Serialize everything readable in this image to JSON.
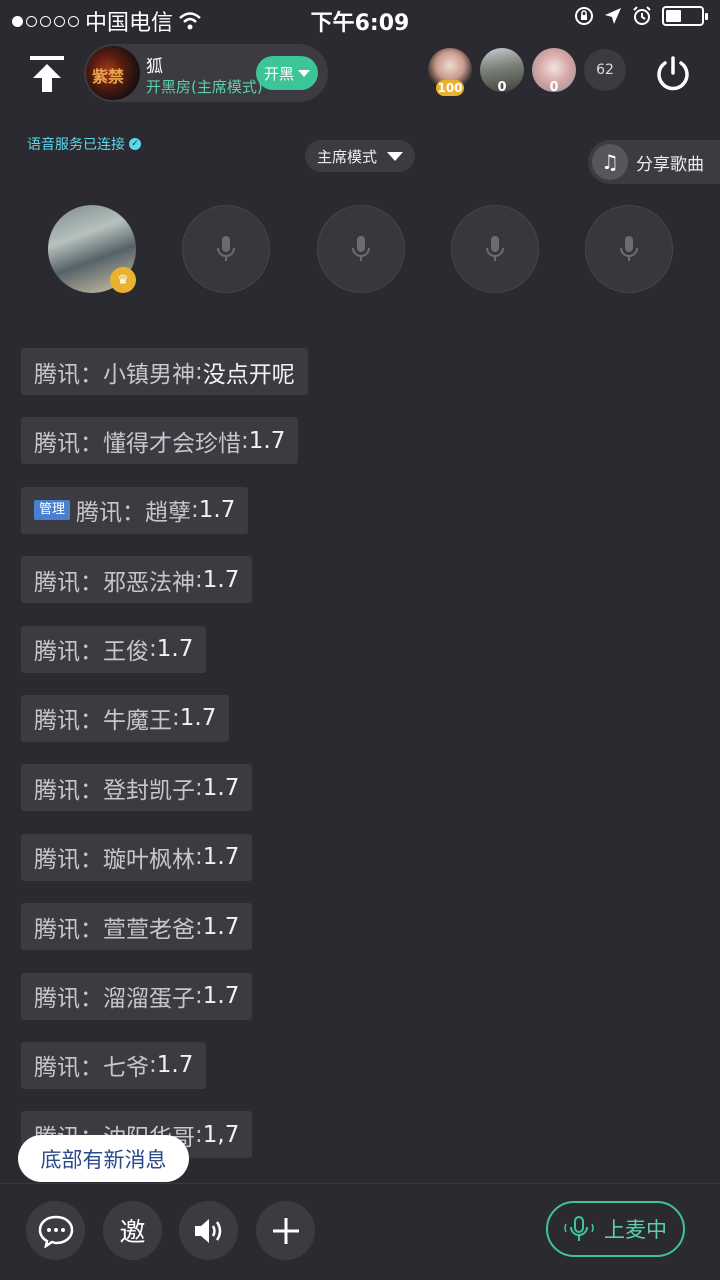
{
  "status_bar": {
    "carrier": "中国电信",
    "time": "下午6:09",
    "battery_level": 0.45
  },
  "header": {
    "room_avatar_text": "紫禁",
    "room_name": "狐",
    "room_subtitle": "开黑房(主席模式)",
    "kaihei_label": "开黑",
    "members": [
      {
        "score": "100"
      },
      {
        "score": "0"
      },
      {
        "score": "0"
      }
    ],
    "member_count": "62"
  },
  "voice_status": "语音服务已连接",
  "mode_label": "主席模式",
  "share_label": "分享歌曲",
  "chat": [
    {
      "prefix": "腾讯：",
      "user": "小镇男神",
      "text": "没点开呢",
      "admin": false
    },
    {
      "prefix": "腾讯：",
      "user": "懂得才会珍惜",
      "text": "1.7",
      "admin": false
    },
    {
      "prefix": "腾讯：",
      "user": "趙孽",
      "text": "1.7",
      "admin": true,
      "admin_label": "管理"
    },
    {
      "prefix": "腾讯：",
      "user": "邪恶法神",
      "text": "1.7",
      "admin": false
    },
    {
      "prefix": "腾讯：",
      "user": "王俊",
      "text": "1.7",
      "admin": false
    },
    {
      "prefix": "腾讯：",
      "user": "牛魔王",
      "text": "1.7",
      "admin": false
    },
    {
      "prefix": "腾讯：",
      "user": "登封凯子",
      "text": "1.7",
      "admin": false
    },
    {
      "prefix": "腾讯：",
      "user": "璇叶枫林",
      "text": "1.7",
      "admin": false
    },
    {
      "prefix": "腾讯：",
      "user": "萱萱老爸",
      "text": "1.7",
      "admin": false
    },
    {
      "prefix": "腾讯：",
      "user": "溜溜蛋子",
      "text": "1.7",
      "admin": false
    },
    {
      "prefix": "腾讯：",
      "user": "七爷",
      "text": "1.7",
      "admin": false
    },
    {
      "prefix": "腾讯：",
      "user": "沈阳华哥",
      "text": "1,7",
      "admin": false
    }
  ],
  "new_message_label": "底部有新消息",
  "toolbar": {
    "invite_label": "邀",
    "mic_label": "上麦中"
  },
  "colors": {
    "background": "#2b2a30",
    "accent_green": "#3cc596",
    "bubble": "#3c3b42"
  }
}
